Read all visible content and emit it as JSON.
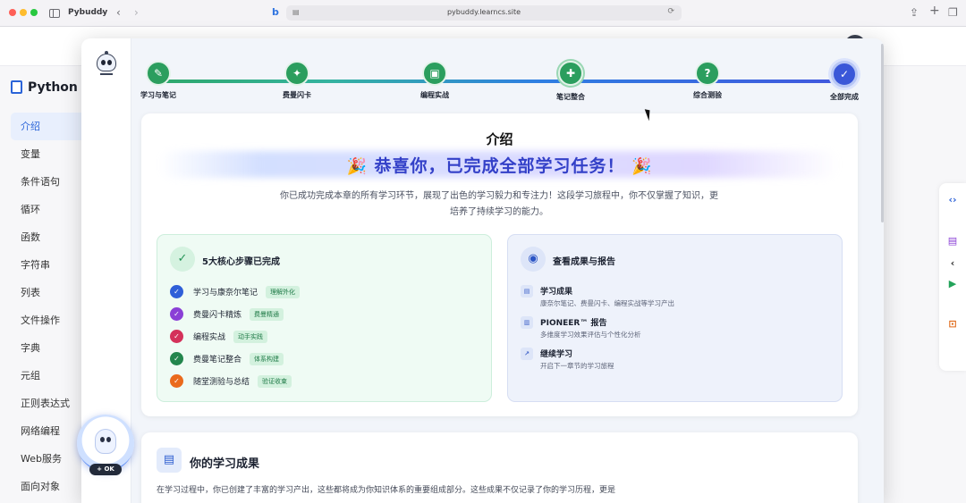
{
  "browser": {
    "app_name": "Pybuddy",
    "url": "pybuddy.learncs.site"
  },
  "background_page": {
    "brand": "Python 教",
    "nav_items": [
      "介绍",
      "变量",
      "条件语句",
      "循环",
      "函数",
      "字符串",
      "列表",
      "文件操作",
      "字典",
      "元组",
      "正则表达式",
      "网络编程",
      "Web服务",
      "面向对象"
    ],
    "active_item": "介绍",
    "assistant_badge": "+ OK"
  },
  "stepper": {
    "steps": [
      {
        "label": "学习与笔记",
        "icon": "edit-icon",
        "glyph": "✎"
      },
      {
        "label": "费曼闪卡",
        "icon": "sparkle-icon",
        "glyph": "✦"
      },
      {
        "label": "编程实战",
        "icon": "code-window-icon",
        "glyph": "▣"
      },
      {
        "label": "笔记整合",
        "icon": "puzzle-icon",
        "glyph": "✚"
      },
      {
        "label": "综合测验",
        "icon": "question-icon",
        "glyph": "?"
      },
      {
        "label": "全部完成",
        "icon": "check-circle-icon",
        "glyph": "✓"
      }
    ],
    "active_index": 5,
    "colors": {
      "done": "#2b9e5e",
      "current": "#3a57d8"
    }
  },
  "intro_card": {
    "title": "介绍",
    "headline": "恭喜你，已完成全部学习任务！",
    "headline_icon": "party-popper-icon",
    "description": "你已成功完成本章的所有学习环节，展现了出色的学习毅力和专注力！这段学习旅程中，你不仅掌握了知识，更培养了持续学习的能力。"
  },
  "completed_panel": {
    "title": "5大核心步骤已完成",
    "tasks": [
      {
        "name": "学习与康奈尔笔记",
        "tag": "理解外化",
        "color": "#2f5fd8"
      },
      {
        "name": "费曼闪卡精炼",
        "tag": "费曼精通",
        "color": "#8a3fd6"
      },
      {
        "name": "编程实战",
        "tag": "动手实践",
        "color": "#d4315a"
      },
      {
        "name": "费曼笔记整合",
        "tag": "体系构建",
        "color": "#23864d"
      },
      {
        "name": "随堂测验与总结",
        "tag": "验证收束",
        "color": "#ea6a1c"
      }
    ]
  },
  "report_panel": {
    "title": "查看成果与报告",
    "items": [
      {
        "title": "学习成果",
        "desc": "康奈尔笔记、费曼闪卡、编程实战等学习产出",
        "icon": "clipboard-icon",
        "glyph": "▤"
      },
      {
        "title": "PIONEER™ 报告",
        "desc": "多维度学习效果评估与个性化分析",
        "icon": "bar-chart-icon",
        "glyph": "▥"
      },
      {
        "title": "继续学习",
        "desc": "开启下一章节的学习旅程",
        "icon": "trend-up-icon",
        "glyph": "↗"
      }
    ]
  },
  "achievements_card": {
    "title": "你的学习成果",
    "text": "在学习过程中，你已创建了丰富的学习产出，这些都将成为你知识体系的重要组成部分。这些成果不仅记录了你的学习历程，更是"
  }
}
